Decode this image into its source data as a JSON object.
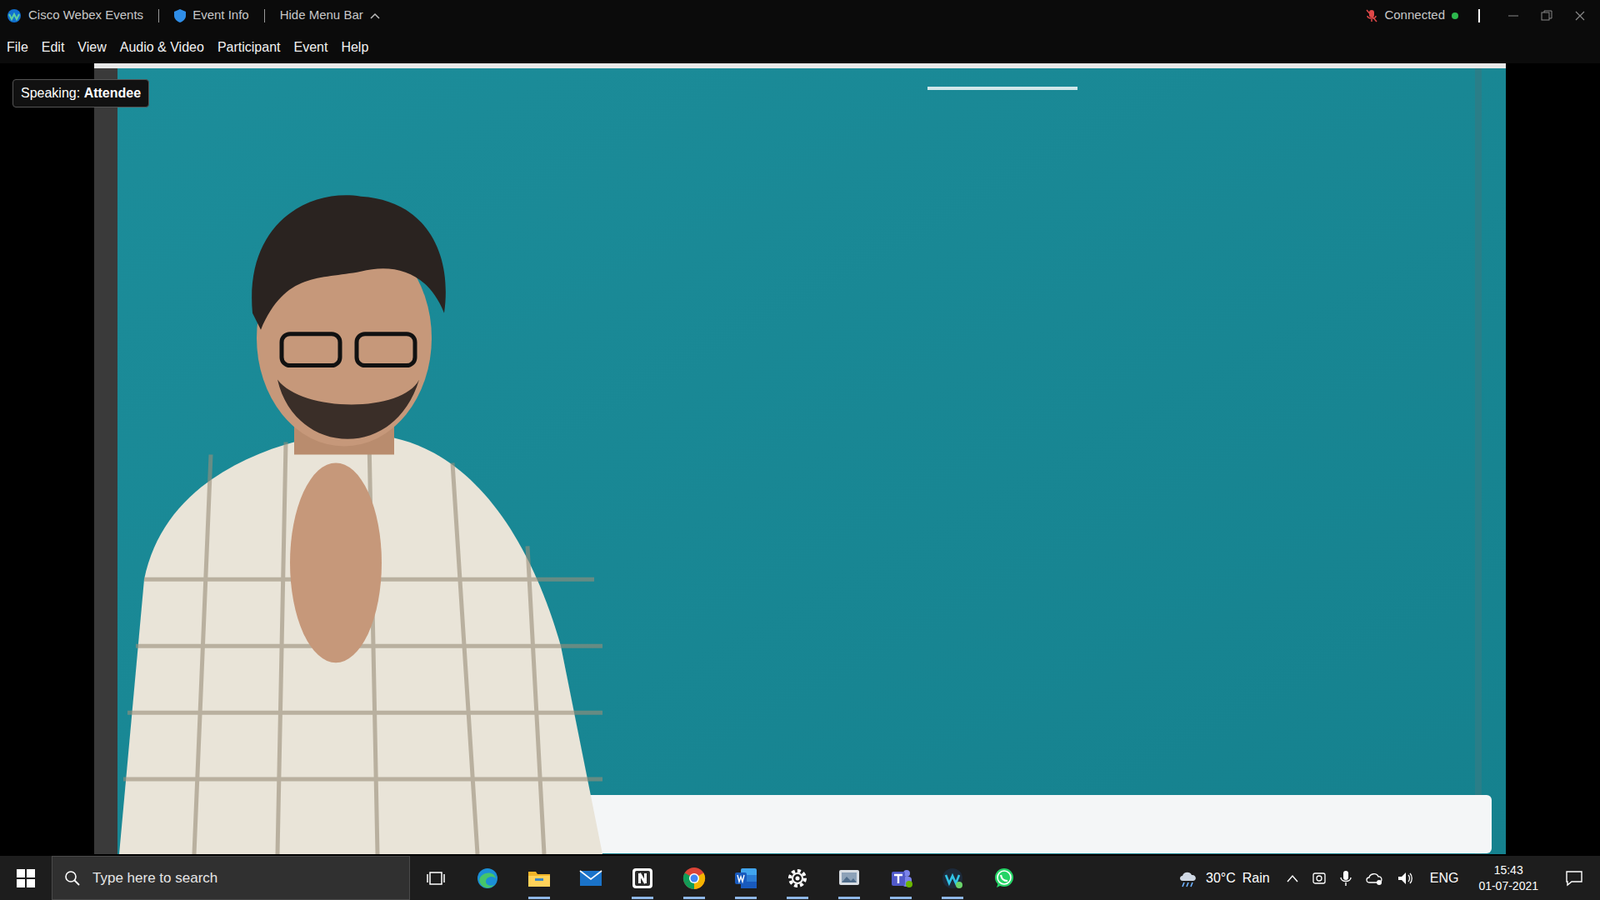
{
  "window": {
    "title": "Cisco Webex Events",
    "event_info": "Event Info",
    "hide_menu": "Hide Menu Bar",
    "status": "Connected",
    "connected": true,
    "status_color": "#2db84d"
  },
  "menu": [
    "File",
    "Edit",
    "View",
    "Audio & Video",
    "Participant",
    "Event",
    "Help"
  ],
  "speaking": {
    "label": "Speaking:",
    "name": "Attendee"
  },
  "taskbar": {
    "search": {
      "placeholder": "Type here to search"
    },
    "apps": [
      {
        "kind": "taskview",
        "running": false
      },
      {
        "kind": "edge",
        "running": false
      },
      {
        "kind": "explorer",
        "running": true
      },
      {
        "kind": "mail",
        "running": false
      },
      {
        "kind": "notes",
        "running": true
      },
      {
        "kind": "chrome",
        "running": true
      },
      {
        "kind": "word",
        "running": true
      },
      {
        "kind": "settings",
        "running": true
      },
      {
        "kind": "viewer",
        "running": true
      },
      {
        "kind": "teams",
        "running": true
      },
      {
        "kind": "webex",
        "running": true
      },
      {
        "kind": "whatsapp",
        "running": false
      }
    ],
    "weather": {
      "temp": "30°C",
      "condition": "Rain"
    },
    "language": "ENG",
    "time": "15:43",
    "date": "01-07-2021"
  }
}
